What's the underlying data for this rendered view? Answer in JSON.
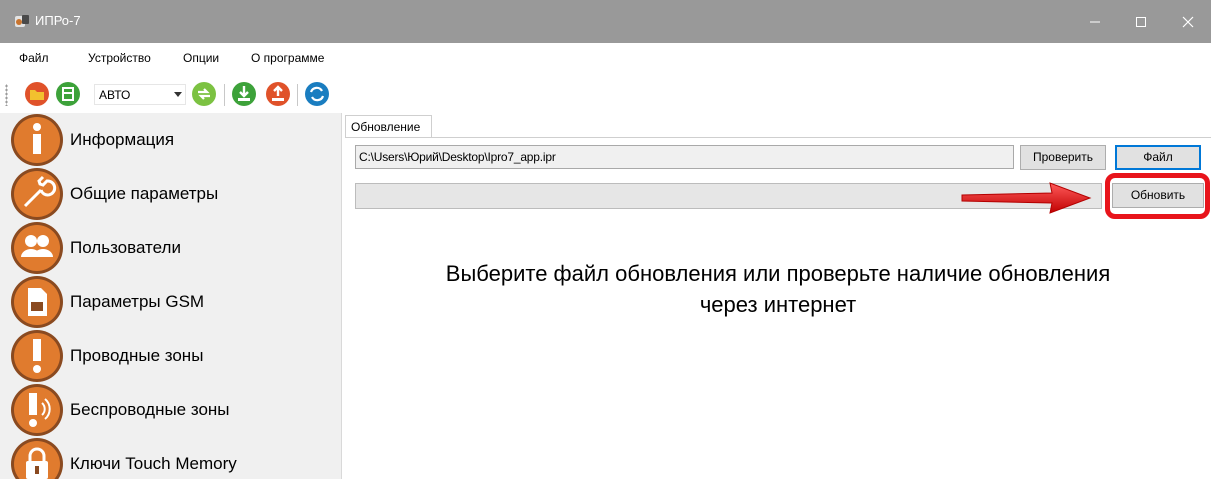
{
  "window": {
    "title": "ИПРо-7",
    "controls": [
      "minimize",
      "maximize",
      "close"
    ]
  },
  "menu": {
    "items": [
      {
        "label": "Файл"
      },
      {
        "label": "Устройство"
      },
      {
        "label": "Опции"
      },
      {
        "label": "О программе"
      }
    ]
  },
  "toolbar": {
    "mode_value": "АВТО",
    "icons": [
      "open-folder-icon",
      "save-icon",
      "connect-icon",
      "download-icon",
      "upload-icon",
      "sync-icon"
    ]
  },
  "sidebar": {
    "items": [
      {
        "label": "Информация",
        "icon": "info-icon"
      },
      {
        "label": "Общие параметры",
        "icon": "wrench-icon"
      },
      {
        "label": "Пользователи",
        "icon": "users-icon"
      },
      {
        "label": "Параметры GSM",
        "icon": "sim-card-icon"
      },
      {
        "label": "Проводные зоны",
        "icon": "exclamation-icon"
      },
      {
        "label": "Беспроводные зоны",
        "icon": "wireless-zone-icon"
      },
      {
        "label": "Ключи Touch Memory",
        "icon": "lock-icon"
      }
    ]
  },
  "main": {
    "tab_label": "Обновление",
    "file_path": "C:\\Users\\Юрий\\Desktop\\Ipro7_app.ipr",
    "check_button": "Проверить",
    "file_button": "Файл",
    "update_button": "Обновить",
    "progress": 0,
    "message_line1": "Выберите файл обновления или проверьте наличие обновления",
    "message_line2": "через интернет"
  },
  "colors": {
    "titlebar": "#999999",
    "icon_orange": "#e07b2e",
    "icon_brown": "#8a4a20",
    "toolbar_green": "#3da23a",
    "toolbar_red": "#e0522a",
    "toolbar_blue": "#1a7dc0",
    "annotation_red": "#e8141b"
  }
}
